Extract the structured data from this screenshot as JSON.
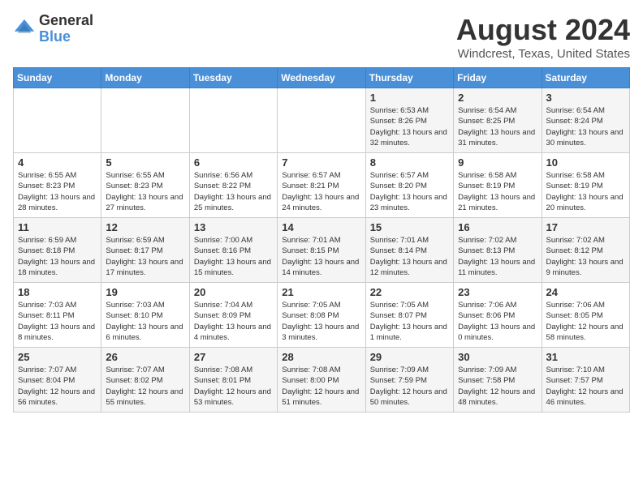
{
  "logo": {
    "general": "General",
    "blue": "Blue"
  },
  "title": "August 2024",
  "subtitle": "Windcrest, Texas, United States",
  "weekdays": [
    "Sunday",
    "Monday",
    "Tuesday",
    "Wednesday",
    "Thursday",
    "Friday",
    "Saturday"
  ],
  "weeks": [
    [
      {
        "day": "",
        "info": ""
      },
      {
        "day": "",
        "info": ""
      },
      {
        "day": "",
        "info": ""
      },
      {
        "day": "",
        "info": ""
      },
      {
        "day": "1",
        "info": "Sunrise: 6:53 AM\nSunset: 8:26 PM\nDaylight: 13 hours\nand 32 minutes."
      },
      {
        "day": "2",
        "info": "Sunrise: 6:54 AM\nSunset: 8:25 PM\nDaylight: 13 hours\nand 31 minutes."
      },
      {
        "day": "3",
        "info": "Sunrise: 6:54 AM\nSunset: 8:24 PM\nDaylight: 13 hours\nand 30 minutes."
      }
    ],
    [
      {
        "day": "4",
        "info": "Sunrise: 6:55 AM\nSunset: 8:23 PM\nDaylight: 13 hours\nand 28 minutes."
      },
      {
        "day": "5",
        "info": "Sunrise: 6:55 AM\nSunset: 8:23 PM\nDaylight: 13 hours\nand 27 minutes."
      },
      {
        "day": "6",
        "info": "Sunrise: 6:56 AM\nSunset: 8:22 PM\nDaylight: 13 hours\nand 25 minutes."
      },
      {
        "day": "7",
        "info": "Sunrise: 6:57 AM\nSunset: 8:21 PM\nDaylight: 13 hours\nand 24 minutes."
      },
      {
        "day": "8",
        "info": "Sunrise: 6:57 AM\nSunset: 8:20 PM\nDaylight: 13 hours\nand 23 minutes."
      },
      {
        "day": "9",
        "info": "Sunrise: 6:58 AM\nSunset: 8:19 PM\nDaylight: 13 hours\nand 21 minutes."
      },
      {
        "day": "10",
        "info": "Sunrise: 6:58 AM\nSunset: 8:19 PM\nDaylight: 13 hours\nand 20 minutes."
      }
    ],
    [
      {
        "day": "11",
        "info": "Sunrise: 6:59 AM\nSunset: 8:18 PM\nDaylight: 13 hours\nand 18 minutes."
      },
      {
        "day": "12",
        "info": "Sunrise: 6:59 AM\nSunset: 8:17 PM\nDaylight: 13 hours\nand 17 minutes."
      },
      {
        "day": "13",
        "info": "Sunrise: 7:00 AM\nSunset: 8:16 PM\nDaylight: 13 hours\nand 15 minutes."
      },
      {
        "day": "14",
        "info": "Sunrise: 7:01 AM\nSunset: 8:15 PM\nDaylight: 13 hours\nand 14 minutes."
      },
      {
        "day": "15",
        "info": "Sunrise: 7:01 AM\nSunset: 8:14 PM\nDaylight: 13 hours\nand 12 minutes."
      },
      {
        "day": "16",
        "info": "Sunrise: 7:02 AM\nSunset: 8:13 PM\nDaylight: 13 hours\nand 11 minutes."
      },
      {
        "day": "17",
        "info": "Sunrise: 7:02 AM\nSunset: 8:12 PM\nDaylight: 13 hours\nand 9 minutes."
      }
    ],
    [
      {
        "day": "18",
        "info": "Sunrise: 7:03 AM\nSunset: 8:11 PM\nDaylight: 13 hours\nand 8 minutes."
      },
      {
        "day": "19",
        "info": "Sunrise: 7:03 AM\nSunset: 8:10 PM\nDaylight: 13 hours\nand 6 minutes."
      },
      {
        "day": "20",
        "info": "Sunrise: 7:04 AM\nSunset: 8:09 PM\nDaylight: 13 hours\nand 4 minutes."
      },
      {
        "day": "21",
        "info": "Sunrise: 7:05 AM\nSunset: 8:08 PM\nDaylight: 13 hours\nand 3 minutes."
      },
      {
        "day": "22",
        "info": "Sunrise: 7:05 AM\nSunset: 8:07 PM\nDaylight: 13 hours\nand 1 minute."
      },
      {
        "day": "23",
        "info": "Sunrise: 7:06 AM\nSunset: 8:06 PM\nDaylight: 13 hours\nand 0 minutes."
      },
      {
        "day": "24",
        "info": "Sunrise: 7:06 AM\nSunset: 8:05 PM\nDaylight: 12 hours\nand 58 minutes."
      }
    ],
    [
      {
        "day": "25",
        "info": "Sunrise: 7:07 AM\nSunset: 8:04 PM\nDaylight: 12 hours\nand 56 minutes."
      },
      {
        "day": "26",
        "info": "Sunrise: 7:07 AM\nSunset: 8:02 PM\nDaylight: 12 hours\nand 55 minutes."
      },
      {
        "day": "27",
        "info": "Sunrise: 7:08 AM\nSunset: 8:01 PM\nDaylight: 12 hours\nand 53 minutes."
      },
      {
        "day": "28",
        "info": "Sunrise: 7:08 AM\nSunset: 8:00 PM\nDaylight: 12 hours\nand 51 minutes."
      },
      {
        "day": "29",
        "info": "Sunrise: 7:09 AM\nSunset: 7:59 PM\nDaylight: 12 hours\nand 50 minutes."
      },
      {
        "day": "30",
        "info": "Sunrise: 7:09 AM\nSunset: 7:58 PM\nDaylight: 12 hours\nand 48 minutes."
      },
      {
        "day": "31",
        "info": "Sunrise: 7:10 AM\nSunset: 7:57 PM\nDaylight: 12 hours\nand 46 minutes."
      }
    ]
  ]
}
